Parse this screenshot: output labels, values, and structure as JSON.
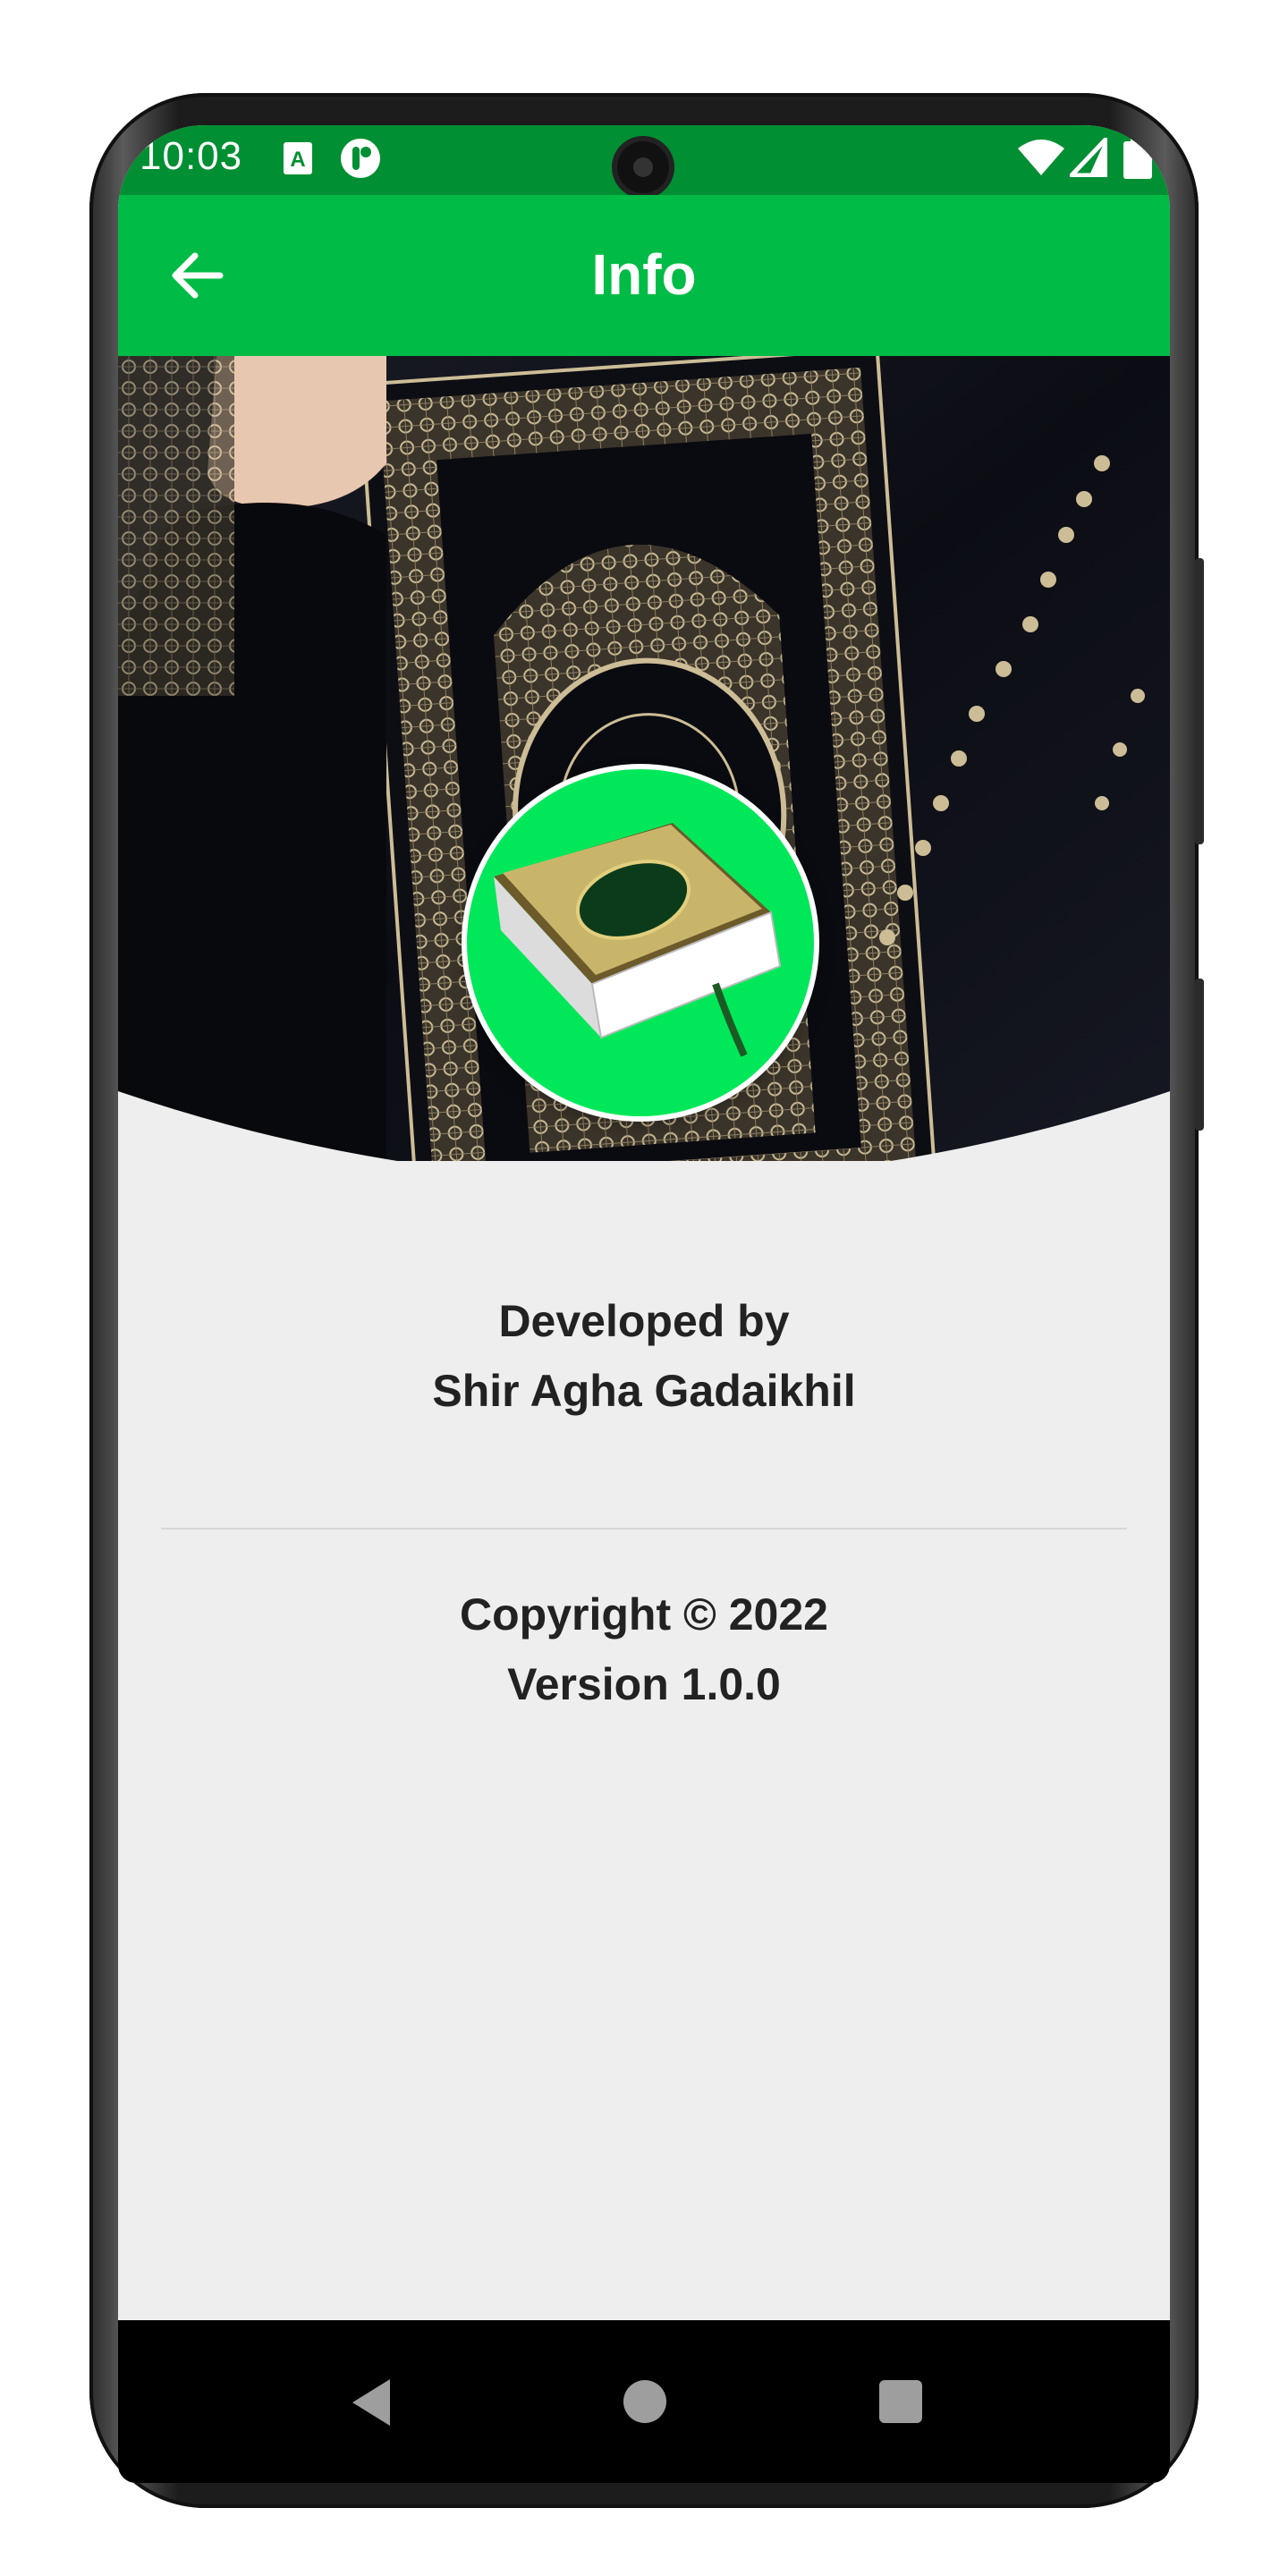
{
  "status_bar": {
    "time": "10:03"
  },
  "app_bar": {
    "title": "Info"
  },
  "info": {
    "developed_by_label": "Developed by",
    "developer_name": "Shir Agha Gadaikhil",
    "copyright": "Copyright © 2022",
    "version": "Version 1.0.0"
  },
  "colors": {
    "status_bar": "#008f32",
    "app_bar": "#00bb45",
    "logo_bg": "#00e859",
    "content_bg": "#eeeeee"
  },
  "icons": [
    "back-arrow-icon",
    "keyboard-a-icon",
    "app-notification-icon",
    "wifi-icon",
    "signal-icon",
    "battery-icon",
    "nav-back-icon",
    "nav-home-icon",
    "nav-recents-icon"
  ]
}
